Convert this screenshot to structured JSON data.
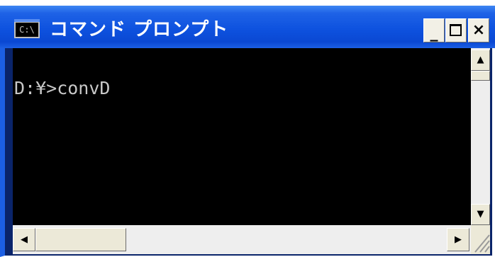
{
  "window": {
    "title": "コマンド プロンプト",
    "icon_text": "C:\\"
  },
  "titlebar_buttons": {
    "minimize_label": "_",
    "close_label": "×"
  },
  "console": {
    "lines": [
      "D:¥>convD"
    ]
  },
  "scrollbar": {
    "up_arrow": "▲",
    "down_arrow": "▼",
    "left_arrow": "◀",
    "right_arrow": "▶"
  },
  "icons": {
    "app": "console-icon",
    "minimize": "minimize-icon",
    "maximize": "maximize-icon",
    "close": "close-icon",
    "resize": "resize-grip-icon"
  },
  "colors": {
    "titlebar": "#0a48d3",
    "console_bg": "#000000",
    "console_fg": "#c8c8c8"
  }
}
